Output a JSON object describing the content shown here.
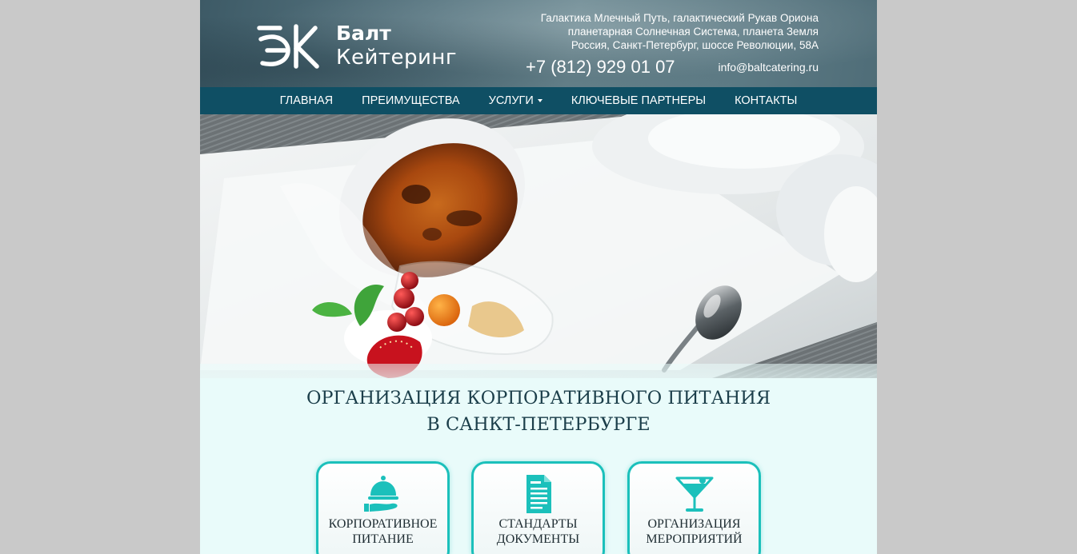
{
  "brand": {
    "name": "Балт",
    "subtitle": "Кейтеринг"
  },
  "contact": {
    "address_lines": [
      "Галактика Млечный Путь, галактический Рукав Ориона",
      "планетарная Солнечная Система, планета Земля",
      "Россия, Санкт-Петербург, шоссе Революции, 58А"
    ],
    "phone": "+7 (812) 929 01 07",
    "email": "info@baltcatering.ru"
  },
  "nav": {
    "items": [
      {
        "label": "ГЛАВНАЯ"
      },
      {
        "label": "ПРЕИМУЩЕСТВА"
      },
      {
        "label": "УСЛУГИ"
      },
      {
        "label": "КЛЮЧЕВЫЕ ПАРТНЕРЫ"
      },
      {
        "label": "КОНТАКТЫ"
      }
    ]
  },
  "headline": {
    "line1": "ОРГАНИЗАЦИЯ КОРПОРАТИВНОГО ПИТАНИЯ",
    "line2": "В САНКТ-ПЕТЕРБУРГЕ"
  },
  "services": [
    {
      "icon": "cloche-icon",
      "line1": "КОРПОРАТИВНОЕ",
      "line2": "ПИТАНИЕ"
    },
    {
      "icon": "document-icon",
      "line1": "СТАНДАРТЫ",
      "line2": "ДОКУМЕНТЫ"
    },
    {
      "icon": "cocktail-icon",
      "line1": "ОРГАНИЗАЦИЯ",
      "line2": "МЕРОПРИЯТИЙ"
    }
  ],
  "colors": {
    "nav_bg": "#0f4f64",
    "accent": "#1bc0bb",
    "headline": "#1b3e4a",
    "page_bg": "#e9fbfa"
  }
}
